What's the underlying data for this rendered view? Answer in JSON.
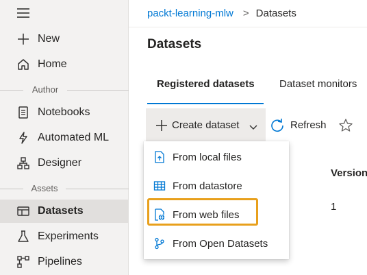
{
  "sidebar": {
    "hamburger_icon": "hamburger-menu-icon",
    "items_top": [
      {
        "label": "New",
        "icon": "plus-icon"
      },
      {
        "label": "Home",
        "icon": "home-icon"
      }
    ],
    "section_author": "Author",
    "items_author": [
      {
        "label": "Notebooks",
        "icon": "notebook-icon"
      },
      {
        "label": "Automated ML",
        "icon": "lightning-icon"
      },
      {
        "label": "Designer",
        "icon": "hierarchy-icon"
      }
    ],
    "section_assets": "Assets",
    "items_assets": [
      {
        "label": "Datasets",
        "icon": "dataset-icon",
        "selected": true
      },
      {
        "label": "Experiments",
        "icon": "flask-icon"
      },
      {
        "label": "Pipelines",
        "icon": "pipeline-icon"
      }
    ]
  },
  "breadcrumb": {
    "workspace": "packt-learning-mlw",
    "separator": ">",
    "current": "Datasets"
  },
  "page_title": "Datasets",
  "tabs": [
    {
      "label": "Registered datasets",
      "active": true
    },
    {
      "label": "Dataset monitors",
      "active": false
    }
  ],
  "toolbar": {
    "create_label": "Create dataset",
    "refresh_label": "Refresh"
  },
  "table": {
    "column_version": "Version",
    "row_version": "1"
  },
  "dropdown": {
    "items": [
      {
        "label": "From local files",
        "icon": "file-upload-icon"
      },
      {
        "label": "From datastore",
        "icon": "table-grid-icon"
      },
      {
        "label": "From web files",
        "icon": "web-file-icon",
        "highlighted": true
      },
      {
        "label": "From Open Datasets",
        "icon": "branch-icon"
      }
    ]
  },
  "colors": {
    "accent": "#0078d4",
    "highlight_border": "#e8a01c",
    "sidebar_bg": "#f3f2f1",
    "selected_bg": "#e1dfdd"
  }
}
